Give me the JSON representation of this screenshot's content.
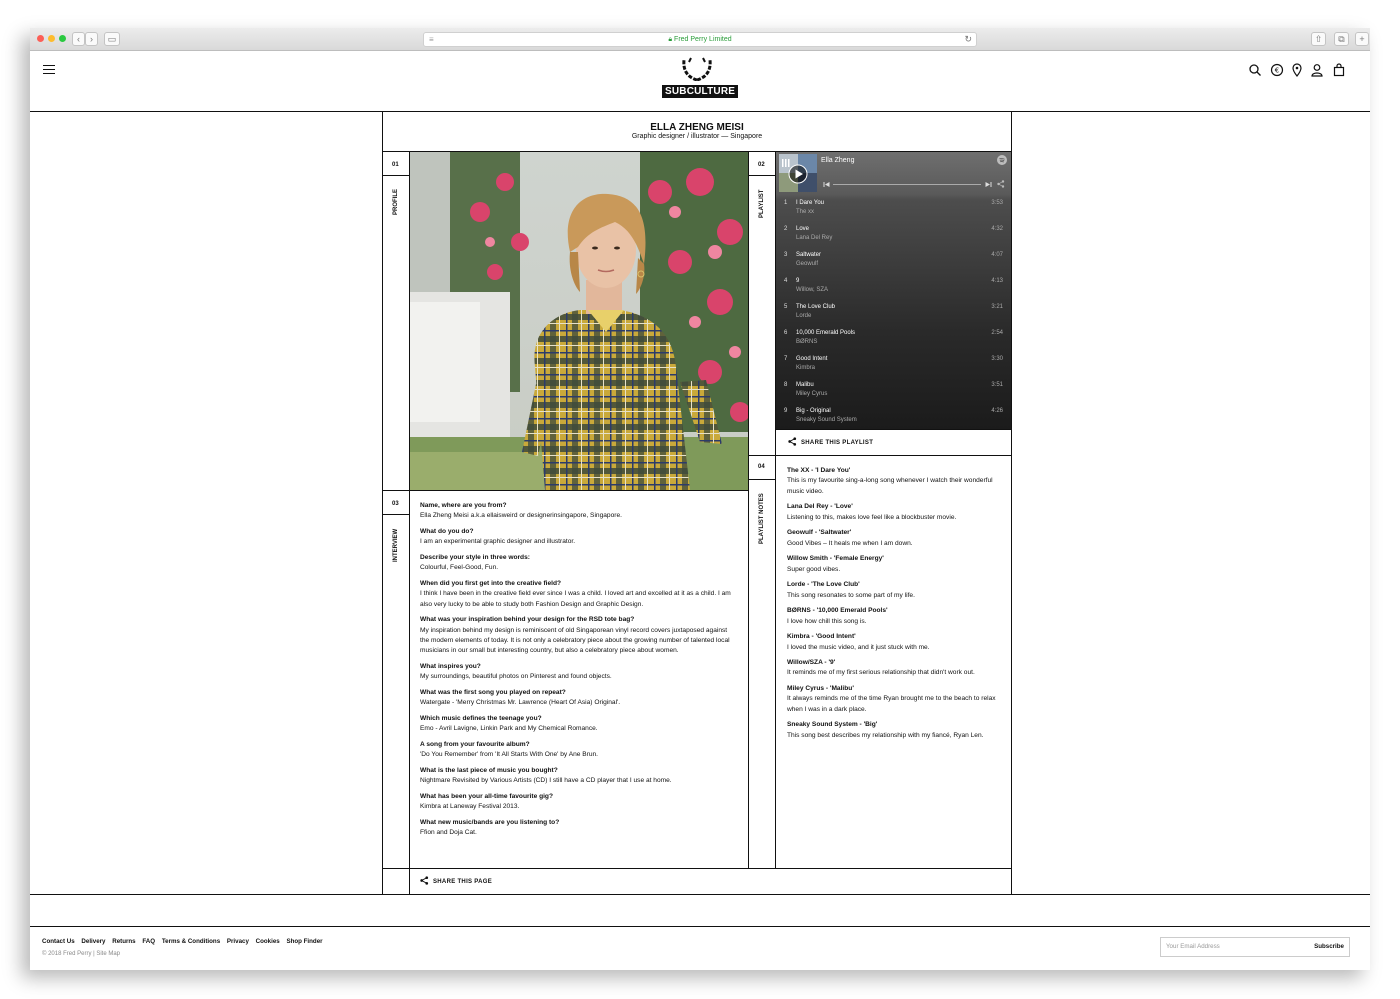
{
  "browser": {
    "url": "Fred Perry Limited"
  },
  "header": {
    "logo_text": "SUBCULTURE",
    "icons": [
      "search-icon",
      "currency-icon",
      "location-pin-icon",
      "account-icon",
      "bag-icon"
    ]
  },
  "article": {
    "title": "ELLA ZHENG MEISI",
    "subtitle": "Graphic designer / illustrator — Singapore",
    "sections": [
      {
        "num": "01",
        "label": "PROFILE"
      },
      {
        "num": "02",
        "label": "PLAYLIST"
      },
      {
        "num": "03",
        "label": "INTERVIEW"
      },
      {
        "num": "04",
        "label": "PLAYLIST NOTES"
      }
    ],
    "share_page": "SHARE THIS PAGE"
  },
  "interview": [
    {
      "q": "Name, where are you from?",
      "a": "Ella Zheng Meisi a.k.a ellaisweird or designerinsingapore, Singapore."
    },
    {
      "q": "What do you do?",
      "a": "I am an experimental graphic designer and illustrator."
    },
    {
      "q": "Describe your style in three words:",
      "a": "Colourful, Feel-Good, Fun."
    },
    {
      "q": "When did you first get into the creative field?",
      "a": "I think I have been in the creative field ever since I was a child. I loved art and excelled at it as a child. I am also very lucky to be able to study both Fashion Design and Graphic Design."
    },
    {
      "q": "What was your inspiration behind your design for the RSD tote bag?",
      "a": "My inspiration behind my design is reminiscent of old Singaporean vinyl record covers juxtaposed against the modern elements of today. It is not only a celebratory piece about the growing number of talented local musicians in our small but interesting country, but also a celebratory piece about women."
    },
    {
      "q": "What inspires you?",
      "a": "My surroundings, beautiful photos on Pinterest and found objects."
    },
    {
      "q": "What was the first song you played on repeat?",
      "a": "Watergate - 'Merry Christmas Mr. Lawrence (Heart Of Asia) Original'."
    },
    {
      "q": "Which music defines the teenage you?",
      "a": "Emo - Avril Lavigne, Linkin Park and My Chemical Romance."
    },
    {
      "q": "A song from your favourite album?",
      "a": "'Do You Remember' from 'It All Starts With One' by Ane Brun."
    },
    {
      "q": "What is the last piece of music you bought?",
      "a": "Nightmare Revisited by Various Artists (CD) I still have a CD player that I use at home."
    },
    {
      "q": "What has been your all-time favourite gig?",
      "a": "Kimbra at Laneway Festival 2013."
    },
    {
      "q": "What new music/bands are you listening to?",
      "a": "Ffion and Doja Cat."
    }
  ],
  "playlist": {
    "name": "Ella Zheng",
    "share": "SHARE THIS PLAYLIST",
    "tracks": [
      {
        "n": "1",
        "title": "I Dare You",
        "artist": "The xx",
        "dur": "3:53"
      },
      {
        "n": "2",
        "title": "Love",
        "artist": "Lana Del Rey",
        "dur": "4:32"
      },
      {
        "n": "3",
        "title": "Saltwater",
        "artist": "Geowulf",
        "dur": "4:07"
      },
      {
        "n": "4",
        "title": "9",
        "artist": "Willow, SZA",
        "dur": "4:13"
      },
      {
        "n": "5",
        "title": "The Love Club",
        "artist": "Lorde",
        "dur": "3:21"
      },
      {
        "n": "6",
        "title": "10,000 Emerald Pools",
        "artist": "BØRNS",
        "dur": "2:54"
      },
      {
        "n": "7",
        "title": "Good Intent",
        "artist": "Kimbra",
        "dur": "3:30"
      },
      {
        "n": "8",
        "title": "Malibu",
        "artist": "Miley Cyrus",
        "dur": "3:51"
      },
      {
        "n": "9",
        "title": "Big - Original",
        "artist": "Sneaky Sound System",
        "dur": "4:26"
      }
    ]
  },
  "notes": [
    {
      "t": "The XX - 'I Dare You'",
      "d": "This is my favourite sing-a-long song whenever I watch their wonderful music video."
    },
    {
      "t": "Lana Del Rey - 'Love'",
      "d": "Listening to this, makes love feel like a blockbuster movie."
    },
    {
      "t": "Geowulf - 'Saltwater'",
      "d": "Good Vibes – It heals me when I am down."
    },
    {
      "t": "Willow Smith - 'Female Energy'",
      "d": "Super good vibes."
    },
    {
      "t": "Lorde - 'The Love Club'",
      "d": "This song resonates to some part of my life."
    },
    {
      "t": "BØRNS - '10,000 Emerald Pools'",
      "d": "I love how chill this song is."
    },
    {
      "t": "Kimbra - 'Good Intent'",
      "d": "I loved the music video, and it just stuck with me."
    },
    {
      "t": "Willow/SZA - '9'",
      "d": "It reminds me of my first serious relationship that didn't work out."
    },
    {
      "t": "Miley Cyrus - 'Malibu'",
      "d": "It always reminds me of the time Ryan brought me to the beach to relax when I was in a dark place."
    },
    {
      "t": "Sneaky Sound System - 'Big'",
      "d": "This song best describes my relationship with my fiancé, Ryan Len."
    }
  ],
  "footer": {
    "links": [
      "Contact Us",
      "Delivery",
      "Returns",
      "FAQ",
      "Terms & Conditions",
      "Privacy",
      "Cookies",
      "Shop Finder"
    ],
    "copyright": "© 2018 Fred Perry | Site Map",
    "email_placeholder": "Your Email Address",
    "subscribe": "Subscribe"
  }
}
